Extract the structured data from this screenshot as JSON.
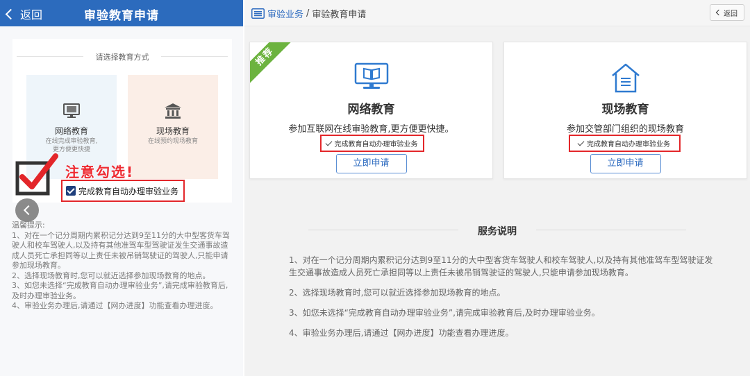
{
  "mobile": {
    "header": {
      "back_label": "返回",
      "title": "审验教育申请"
    },
    "choose_label": "请选择教育方式",
    "cards": [
      {
        "name": "网络教育",
        "desc1": "在线完成审验教育,",
        "desc2": "更方便更快捷"
      },
      {
        "name": "现场教育",
        "desc1": "在线预约现场教育",
        "desc2": ""
      }
    ],
    "warning_text": "注意勾选!",
    "checkbox_label": "完成教育自动办理审验业务",
    "tips": {
      "title": "温馨提示:",
      "items": [
        "1、对在一个记分周期内累积记分达到9至11分的大中型客货车驾驶人和校车驾驶人,以及持有其他准驾车型驾驶证发生交通事故造成人员死亡承担同等以上责任未被吊销驾驶证的驾驶人,只能申请参加现场教育。",
        "2、选择现场教育时,您可以就近选择参加现场教育的地点。",
        "3、如您未选择“完成教育自动办理审验业务”,请完成审验教育后,及时办理审验业务。",
        "4、审验业务办理后,请通过【网办进度】功能查看办理进度。"
      ]
    }
  },
  "desktop": {
    "breadcrumb": {
      "link": "审验业务",
      "separator": "/",
      "current": "审验教育申请"
    },
    "back_button": "返回",
    "ribbon": "推荐",
    "cards": [
      {
        "name": "网络教育",
        "desc": "参加互联网在线审验教育,更方便更快捷。",
        "auto_label": "完成教育自动办理审验业务",
        "button": "立即申请"
      },
      {
        "name": "现场教育",
        "desc": "参加交管部门组织的现场教育",
        "auto_label": "完成教育自动办理审验业务",
        "button": "立即申请"
      }
    ],
    "service": {
      "title": "服务说明",
      "items": [
        "1、对在一个记分周期内累积记分达到9至11分的大中型客货车驾驶人和校车驾驶人,以及持有其他准驾车型驾驶证发生交通事故造成人员死亡承担同等以上责任未被吊销驾驶证的驾驶人,只能申请参加现场教育。",
        "2、选择现场教育时,您可以就近选择参加现场教育的地点。",
        "3、如您未选择“完成教育自动办理审验业务”,请完成审验教育后,及时办理审验业务。",
        "4、审验业务办理后,请通过【网办进度】功能查看办理进度。"
      ]
    }
  },
  "colors": {
    "mobile_header": "#2c6bbd",
    "link_blue": "#2f6cc0",
    "highlight_red": "#e3262a",
    "ribbon_green": "#6cb33f",
    "checkbox_navy": "#1f3f7c"
  },
  "icons": [
    "chevron-left-icon",
    "monitor-book-icon",
    "bank-building-icon",
    "house-list-icon",
    "checkmark-icon",
    "list-icon"
  ]
}
